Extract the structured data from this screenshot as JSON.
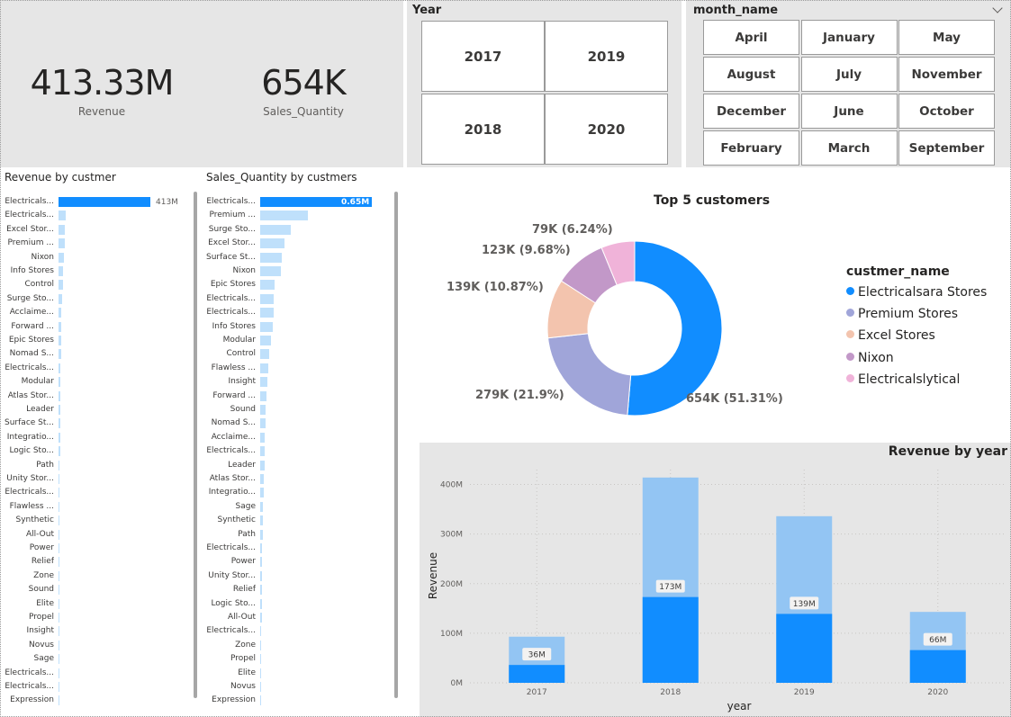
{
  "kpis": {
    "revenue": {
      "value": "413.33M",
      "label": "Revenue"
    },
    "quantity": {
      "value": "654K",
      "label": "Sales_Quantity"
    }
  },
  "year_slicer": {
    "title": "Year",
    "options": [
      "2017",
      "2019",
      "2018",
      "2020"
    ]
  },
  "month_slicer": {
    "title": "month_name",
    "options": [
      "April",
      "January",
      "May",
      "August",
      "July",
      "November",
      "December",
      "June",
      "October",
      "February",
      "March",
      "September"
    ]
  },
  "revenue_by_customer": {
    "title": "Revenue by custmer",
    "top_value_label": "413M",
    "names": [
      "Electricals...",
      "Electricals...",
      "Excel Stor...",
      "Premium ...",
      "Nixon",
      "Info Stores",
      "Control",
      "Surge Sto...",
      "Acclaime...",
      "Forward ...",
      "Epic Stores",
      "Nomad S...",
      "Electricals...",
      "Modular",
      "Atlas Stor...",
      "Leader",
      "Surface St...",
      "Integratio...",
      "Logic Sto...",
      "Path",
      "Unity Stor...",
      "Electricals...",
      "Flawless ...",
      "Synthetic",
      "All-Out",
      "Power",
      "Relief",
      "Zone",
      "Sound",
      "Elite",
      "Propel",
      "Insight",
      "Novus",
      "Sage",
      "Electricals...",
      "Electricals...",
      "Expression"
    ],
    "values": [
      413,
      32,
      30,
      28,
      26,
      22,
      20,
      18,
      14,
      13,
      12,
      11,
      10,
      9,
      9,
      8,
      8,
      7,
      7,
      6,
      6,
      6,
      5,
      5,
      5,
      4,
      4,
      4,
      3,
      3,
      3,
      3,
      2,
      2,
      2,
      2,
      1
    ]
  },
  "quantity_by_customer": {
    "title": "Sales_Quantity by custmers",
    "top_value_label": "0.65M",
    "names": [
      "Electricals...",
      "Premium ...",
      "Surge Sto...",
      "Excel Stor...",
      "Surface St...",
      "Nixon",
      "Epic Stores",
      "Electricals...",
      "Electricals...",
      "Info Stores",
      "Modular",
      "Control",
      "Flawless ...",
      "Insight",
      "Forward ...",
      "Sound",
      "Nomad S...",
      "Acclaime...",
      "Electricals...",
      "Leader",
      "Atlas Stor...",
      "Integratio...",
      "Sage",
      "Synthetic",
      "Path",
      "Electricals...",
      "Power",
      "Unity Stor...",
      "Relief",
      "Logic Sto...",
      "All-Out",
      "Electricals...",
      "Zone",
      "Propel",
      "Elite",
      "Novus",
      "Expression"
    ],
    "values": [
      650,
      280,
      180,
      140,
      125,
      120,
      85,
      80,
      78,
      75,
      65,
      50,
      45,
      42,
      38,
      32,
      30,
      28,
      26,
      24,
      22,
      20,
      18,
      16,
      14,
      13,
      12,
      11,
      10,
      9,
      8,
      7,
      6,
      5,
      4,
      3,
      2
    ]
  },
  "top5": {
    "title": "Top 5 customers",
    "legend_title": "custmer_name",
    "items": [
      {
        "name": "Electricalsara Stores",
        "value": 654,
        "label": "654K (51.31%)",
        "color": "#118dff"
      },
      {
        "name": "Premium Stores",
        "value": 279,
        "label": "279K (21.9%)",
        "color": "#a0a5d9"
      },
      {
        "name": "Excel Stores",
        "value": 139,
        "label": "139K (10.87%)",
        "color": "#f3c4ae"
      },
      {
        "name": "Nixon",
        "value": 123,
        "label": "123K (9.68%)",
        "color": "#c298c8"
      },
      {
        "name": "Electricalslytical",
        "value": 79,
        "label": "79K (6.24%)",
        "color": "#f0b3d9"
      }
    ]
  },
  "chart_data": {
    "type": "bar",
    "title": "Revenue by year",
    "xlabel": "year",
    "ylabel": "Revenue",
    "categories": [
      "2017",
      "2018",
      "2019",
      "2020"
    ],
    "yticks": [
      "0M",
      "100M",
      "200M",
      "300M",
      "400M"
    ],
    "ylim": [
      0,
      430
    ],
    "series": [
      {
        "values": [
          93,
          414,
          336,
          143
        ],
        "color": "#93c5f3"
      },
      {
        "values": [
          36,
          173,
          139,
          66
        ],
        "color": "#118dff"
      }
    ],
    "data_labels": [
      "36M",
      "173M",
      "139M",
      "66M"
    ]
  }
}
